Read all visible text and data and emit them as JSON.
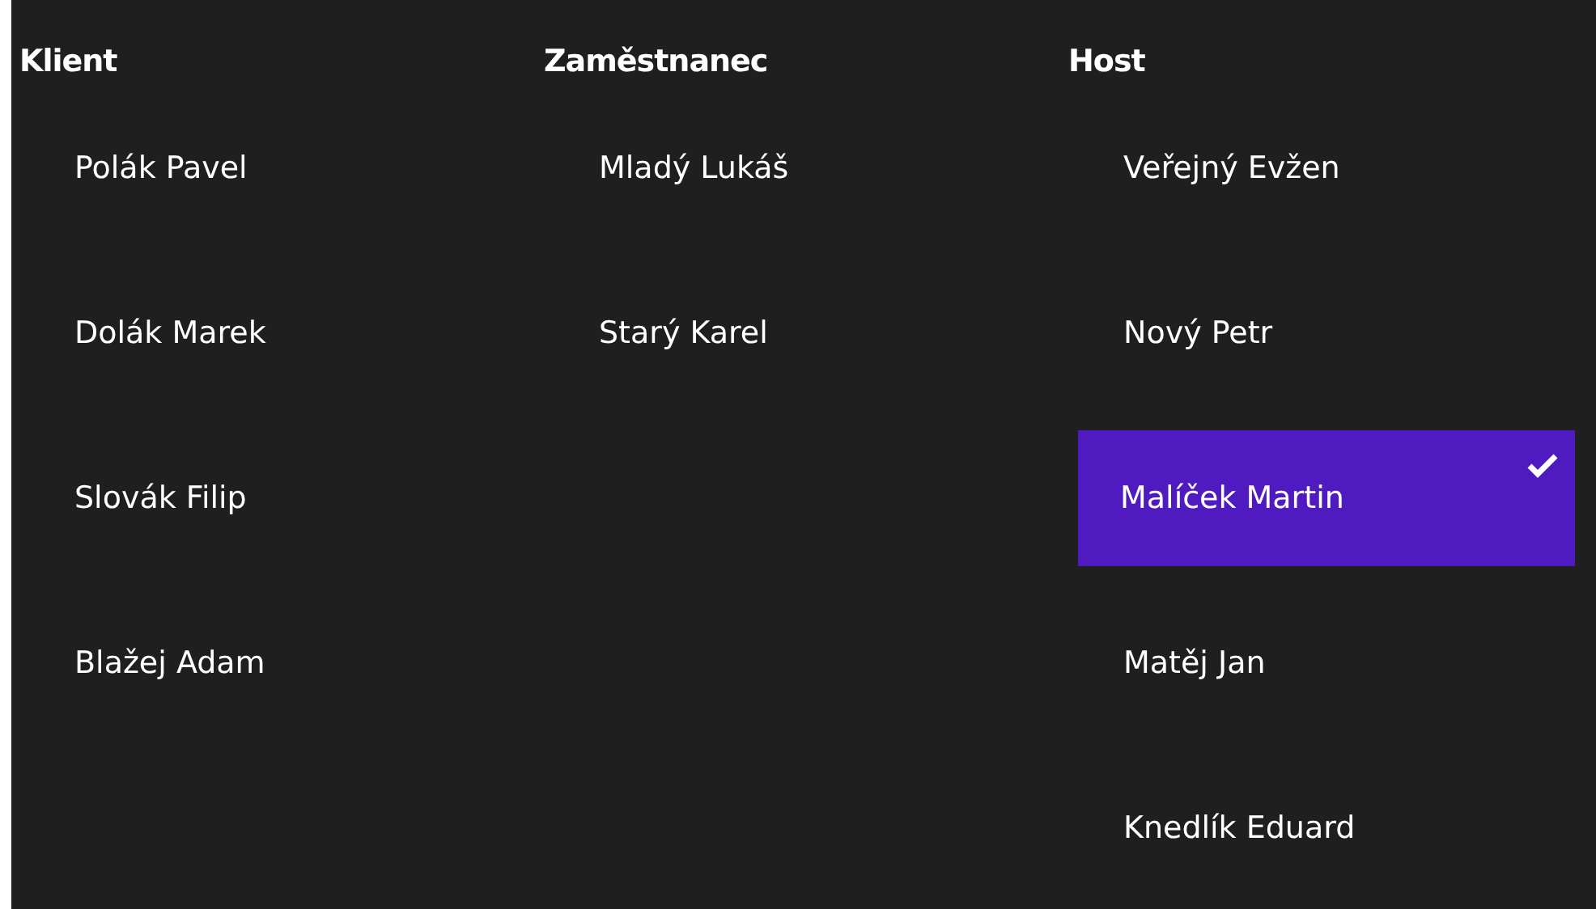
{
  "groups": [
    {
      "title": "Klient",
      "items": [
        {
          "label": "Polák Pavel",
          "selected": false
        },
        {
          "label": "Dolák Marek",
          "selected": false
        },
        {
          "label": "Slovák Filip",
          "selected": false
        },
        {
          "label": "Blažej Adam",
          "selected": false
        }
      ]
    },
    {
      "title": "Zaměstnanec",
      "items": [
        {
          "label": "Mladý Lukáš",
          "selected": false
        },
        {
          "label": "Starý Karel",
          "selected": false
        }
      ]
    },
    {
      "title": "Host",
      "items": [
        {
          "label": "Veřejný Evžen",
          "selected": false
        },
        {
          "label": "Nový Petr",
          "selected": false
        },
        {
          "label": "Malíček Martin",
          "selected": true
        },
        {
          "label": "Matěj Jan",
          "selected": false
        },
        {
          "label": "Knedlík Eduard",
          "selected": false
        }
      ]
    }
  ]
}
